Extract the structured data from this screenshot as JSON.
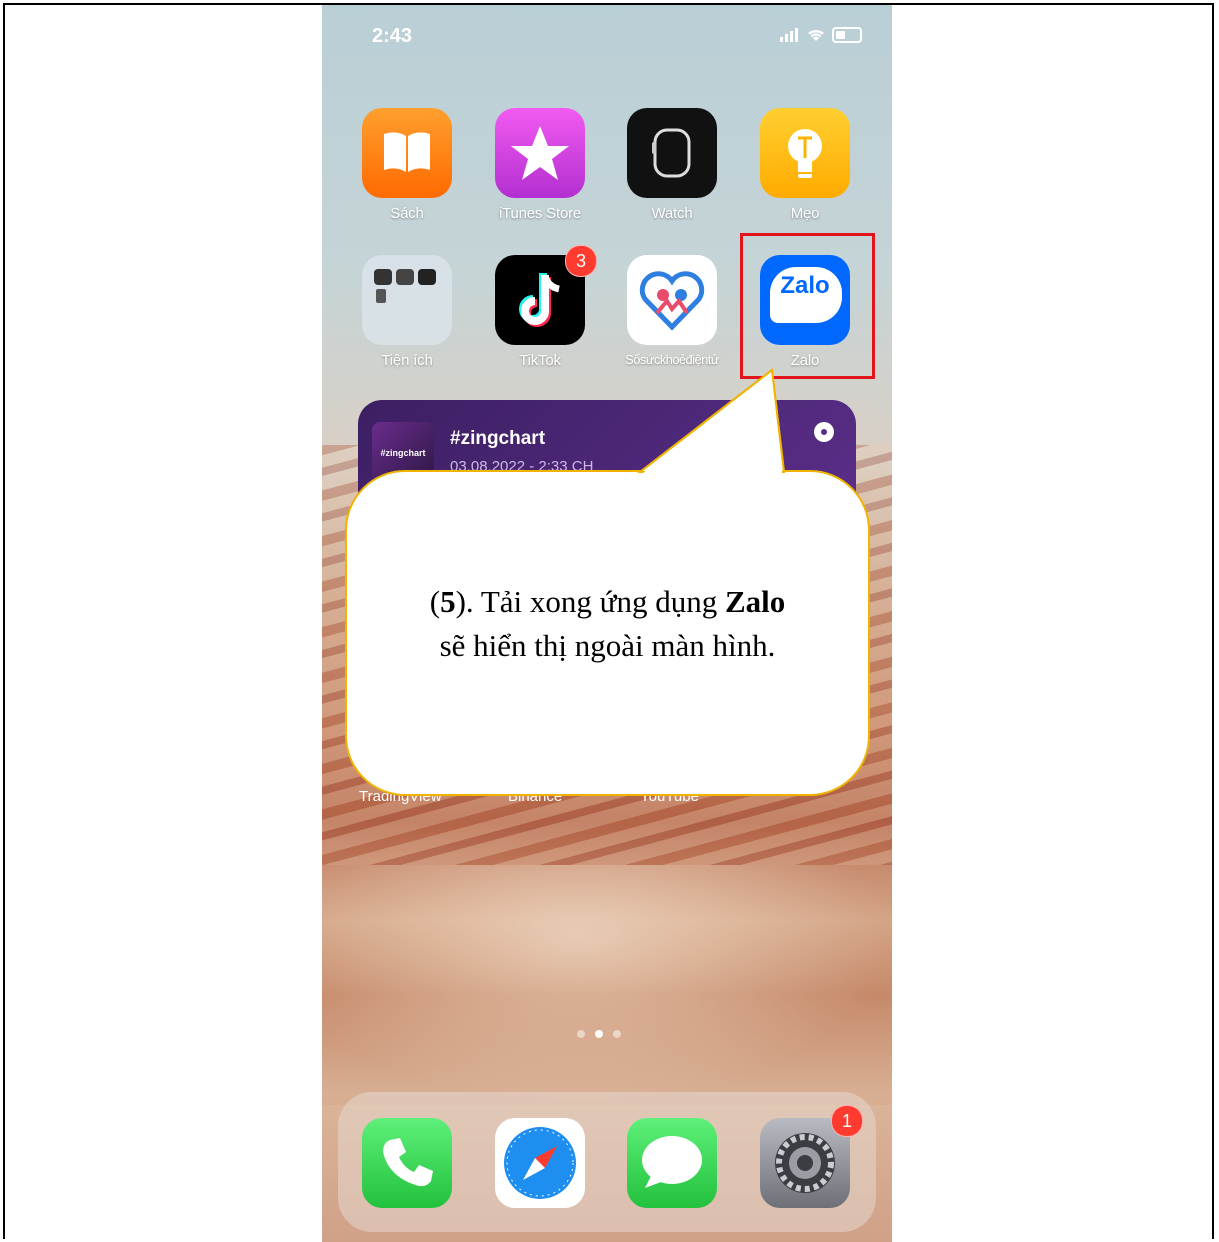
{
  "status_bar": {
    "time": "2:43"
  },
  "apps_row1": [
    {
      "label": "Sách",
      "icon": "books-icon"
    },
    {
      "label": "iTunes Store",
      "icon": "itunes-star-icon"
    },
    {
      "label": "Watch",
      "icon": "watch-icon"
    },
    {
      "label": "Mẹo",
      "icon": "tips-bulb-icon"
    }
  ],
  "apps_row2": [
    {
      "label": "Tiện ích",
      "icon": "utilities-folder-icon"
    },
    {
      "label": "TikTok",
      "icon": "tiktok-icon",
      "badge": "3"
    },
    {
      "label": "Sổsứckhoẻđiệntử",
      "icon": "health-heart-icon"
    },
    {
      "label": "Zalo",
      "icon": "zalo-icon",
      "icon_text": "Zalo"
    }
  ],
  "widget": {
    "thumb_text": "#zingchart",
    "title": "#zingchart",
    "date": "03.08.2022 - 2:33 CH"
  },
  "partially_hidden_labels": [
    "TradingView",
    "Binance",
    "YouTube"
  ],
  "dock": [
    {
      "icon": "phone-icon"
    },
    {
      "icon": "safari-compass-icon"
    },
    {
      "icon": "messages-icon"
    },
    {
      "icon": "settings-gear-icon",
      "badge": "1"
    }
  ],
  "callout": {
    "prefix": "(",
    "step": "5",
    "middle": "). Tải xong ứng dụng ",
    "app_name": "Zalo",
    "line2": "sẽ hiển thị ngoài màn hình."
  },
  "colors": {
    "highlight": "#e1141c",
    "callout_border": "#f0b400",
    "zalo_blue": "#0068ff",
    "badge_red": "#ff3b30"
  }
}
